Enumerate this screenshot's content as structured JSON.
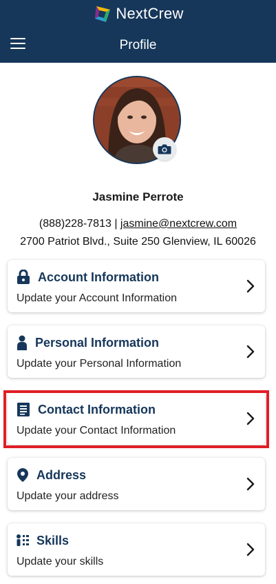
{
  "header": {
    "brand": "NextCrew",
    "title": "Profile"
  },
  "profile": {
    "name": "Jasmine Perrote",
    "phone": "(888)228-7813",
    "separator": "|",
    "email": "jasmine@nextcrew.com",
    "address": "2700 Patriot Blvd., Suite 250 Glenview, IL 60026"
  },
  "cards": [
    {
      "title": "Account Information",
      "subtitle": "Update your Account Information",
      "icon": "lock-icon"
    },
    {
      "title": "Personal Information",
      "subtitle": "Update your Personal Information",
      "icon": "person-icon"
    },
    {
      "title": "Contact Information",
      "subtitle": "Update your Contact Information",
      "icon": "contact-book-icon"
    },
    {
      "title": "Address",
      "subtitle": "Update your address",
      "icon": "map-pin-icon"
    },
    {
      "title": "Skills",
      "subtitle": "Update your skills",
      "icon": "skills-icon"
    }
  ],
  "colors": {
    "header_bg": "#16375a",
    "accent_text": "#16375a",
    "highlight": "#e01e26"
  }
}
